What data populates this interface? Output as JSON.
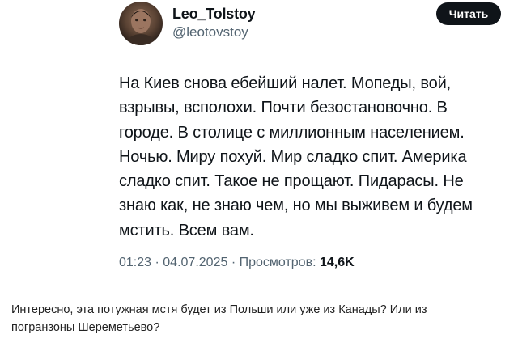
{
  "tweet": {
    "author": {
      "name": "Leo_Tolstoy",
      "handle": "@leotovstoy"
    },
    "follow_button_label": "Читать",
    "text_lines": [
      "На Киев снова ебейший налет. Мопеды, вой,",
      "взрывы, всполохи. Почти безостановочно. В",
      "городе. В столице с миллионным населением.",
      "Ночью. Миру похуй. Мир сладко спит. Америка",
      "сладко спит. Такое не прощают. Пидарасы. Не",
      "знаю как, не знаю чем, но мы выживем и будем",
      "мстить. Всем вам."
    ],
    "meta": {
      "time": "01:23",
      "separator": "·",
      "date": "04.07.2025",
      "views_label": "Просмотров:",
      "views_count": "14,6K"
    }
  },
  "comment": {
    "lines": [
      "Интересно, эта потужная мстя будет из Польши или уже из Канады? Или из",
      "погранзоны Шереметьево?"
    ]
  }
}
